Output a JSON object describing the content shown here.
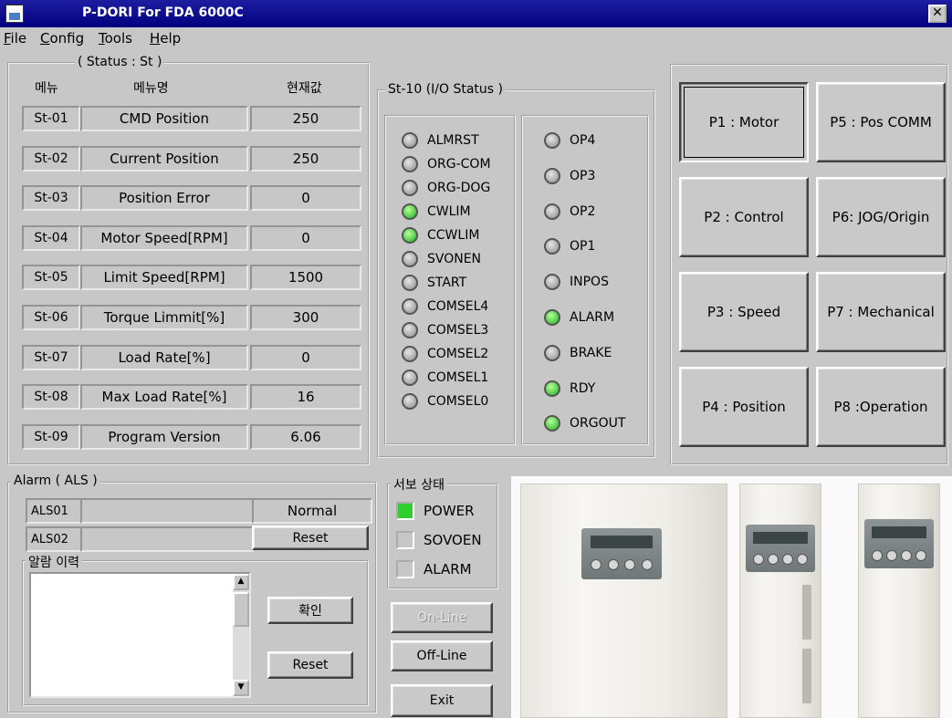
{
  "window": {
    "title": "P-DORI For FDA 6000C",
    "close_label": "✕"
  },
  "menu": [
    "File",
    "Config",
    "Tools",
    "Help"
  ],
  "status": {
    "title": "( Status : St )",
    "headers": {
      "menu": "메뉴",
      "menu_name": "메뉴명",
      "current": "현재값"
    },
    "rows": [
      {
        "code": "St-01",
        "name": "CMD Position",
        "value": "250"
      },
      {
        "code": "St-02",
        "name": "Current Position",
        "value": "250"
      },
      {
        "code": "St-03",
        "name": "Position Error",
        "value": "0"
      },
      {
        "code": "St-04",
        "name": "Motor Speed[RPM]",
        "value": "0"
      },
      {
        "code": "St-05",
        "name": "Limit Speed[RPM]",
        "value": "1500"
      },
      {
        "code": "St-06",
        "name": "Torque Limmit[%]",
        "value": "300"
      },
      {
        "code": "St-07",
        "name": "Load Rate[%]",
        "value": "0"
      },
      {
        "code": "St-08",
        "name": "Max Load Rate[%]",
        "value": "16"
      },
      {
        "code": "St-09",
        "name": "Program Version",
        "value": "6.06"
      }
    ]
  },
  "io": {
    "title": "St-10 (I/O Status )",
    "inputs": [
      {
        "label": "ALMRST",
        "on": false
      },
      {
        "label": "ORG-COM",
        "on": false
      },
      {
        "label": "ORG-DOG",
        "on": false
      },
      {
        "label": "CWLIM",
        "on": true
      },
      {
        "label": "CCWLIM",
        "on": true
      },
      {
        "label": "SVONEN",
        "on": false
      },
      {
        "label": "START",
        "on": false
      },
      {
        "label": "COMSEL4",
        "on": false
      },
      {
        "label": "COMSEL3",
        "on": false
      },
      {
        "label": "COMSEL2",
        "on": false
      },
      {
        "label": "COMSEL1",
        "on": false
      },
      {
        "label": "COMSEL0",
        "on": false
      }
    ],
    "outputs": [
      {
        "label": "OP4",
        "on": false
      },
      {
        "label": "OP3",
        "on": false
      },
      {
        "label": "OP2",
        "on": false
      },
      {
        "label": "OP1",
        "on": false
      },
      {
        "label": "INPOS",
        "on": false
      },
      {
        "label": "ALARM",
        "on": true
      },
      {
        "label": "BRAKE",
        "on": false
      },
      {
        "label": "RDY",
        "on": true
      },
      {
        "label": "ORGOUT",
        "on": true
      }
    ]
  },
  "params": [
    "P1 : Motor",
    "P5 : Pos COMM",
    "P2 : Control",
    "P6: JOG/Origin",
    "P3 : Speed",
    "P7 : Mechanical",
    "P4 : Position",
    "P8 :Operation"
  ],
  "alarm": {
    "title": "Alarm ( ALS )",
    "rows": [
      {
        "code": "ALS01",
        "value": "Normal"
      },
      {
        "code": "ALS02",
        "button": "Reset"
      }
    ],
    "history_title": "알람 이력",
    "confirm_label": "확인",
    "reset_label": "Reset"
  },
  "servo": {
    "title": "서보 상태",
    "items": [
      {
        "label": "POWER",
        "on": true
      },
      {
        "label": "SOVOEN",
        "on": false
      },
      {
        "label": "ALARM",
        "on": false
      }
    ]
  },
  "controls": {
    "online": "On-Line",
    "offline": "Off-Line",
    "exit": "Exit"
  },
  "colors": {
    "titlebar": "#000080",
    "led_on": "#19b219",
    "background": "#c7c7c7"
  }
}
